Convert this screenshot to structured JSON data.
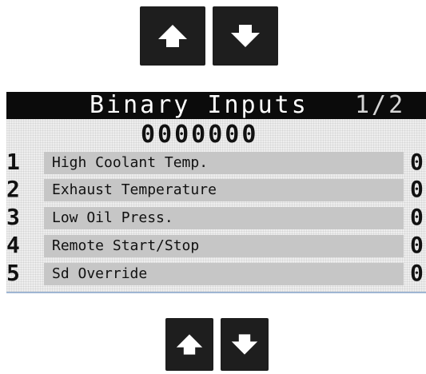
{
  "screen": {
    "title": "Binary Inputs",
    "page": "1/2",
    "bits": "0000000"
  },
  "inputs": [
    {
      "number": "1",
      "label": "High Coolant Temp.",
      "value": "0"
    },
    {
      "number": "2",
      "label": "Exhaust Temperature",
      "value": "0"
    },
    {
      "number": "3",
      "label": "Low Oil Press.",
      "value": "0"
    },
    {
      "number": "4",
      "label": "Remote Start/Stop",
      "value": "0"
    },
    {
      "number": "5",
      "label": "Sd Override",
      "value": "0"
    }
  ],
  "icons": {
    "up": "arrow-up-icon",
    "down": "arrow-down-icon"
  },
  "colors": {
    "button_bg": "#1e1e1e",
    "header_bg": "#0b0b0b",
    "row_bar": "#c6c6c6"
  }
}
